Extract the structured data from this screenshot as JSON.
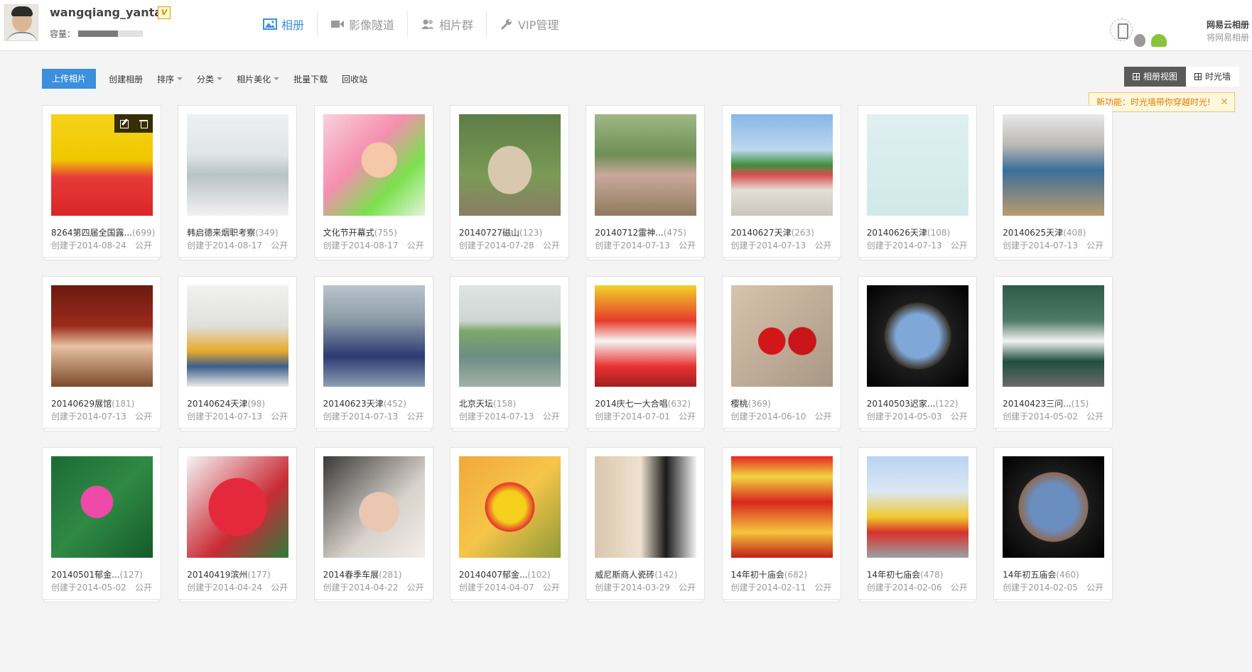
{
  "header": {
    "username": "wangqiang_yantai",
    "vip_badge": "V",
    "capacity_label": "容量：",
    "capacity_used_fraction": 0.62,
    "nav": [
      {
        "label": "相册",
        "icon": "photo-icon",
        "active": true
      },
      {
        "label": "影像隧道",
        "icon": "video-icon",
        "active": false
      },
      {
        "label": "相片群",
        "icon": "people-icon",
        "active": false
      },
      {
        "label": "VIP管理",
        "icon": "wrench-icon",
        "active": false
      }
    ],
    "promo_title": "网易云相册",
    "promo_sub": "将网易相册"
  },
  "toolbar": {
    "upload": "上传相片",
    "create": "创建相册",
    "sort": "排序",
    "category": "分类",
    "beautify": "相片美化",
    "batch_download": "批量下载",
    "recycle": "回收站"
  },
  "views": {
    "album_view": "相册视图",
    "timeline": "时光墙"
  },
  "tip": {
    "text": "新功能：时光墙带你穿越时光!",
    "close": "✕"
  },
  "albums": [
    {
      "title": "8264第四届全国露...",
      "count": "(699)",
      "date": "创建于2014-08-24",
      "privacy": "公开"
    },
    {
      "title": "韩启德来烟职考察",
      "count": "(349)",
      "date": "创建于2014-08-17",
      "privacy": "公开"
    },
    {
      "title": "文化节开幕式",
      "count": "(755)",
      "date": "创建于2014-08-17",
      "privacy": "公开"
    },
    {
      "title": "20140727磁山",
      "count": "(123)",
      "date": "创建于2014-07-28",
      "privacy": "公开"
    },
    {
      "title": "20140712雷神...",
      "count": "(475)",
      "date": "创建于2014-07-13",
      "privacy": "公开"
    },
    {
      "title": "20140627天津",
      "count": "(263)",
      "date": "创建于2014-07-13",
      "privacy": "公开"
    },
    {
      "title": "20140626天津",
      "count": "(108)",
      "date": "创建于2014-07-13",
      "privacy": "公开"
    },
    {
      "title": "20140625天津",
      "count": "(408)",
      "date": "创建于2014-07-13",
      "privacy": "公开"
    },
    {
      "title": "20140629展馆",
      "count": "(181)",
      "date": "创建于2014-07-13",
      "privacy": "公开"
    },
    {
      "title": "20140624天津",
      "count": "(98)",
      "date": "创建于2014-07-13",
      "privacy": "公开"
    },
    {
      "title": "20140623天津",
      "count": "(452)",
      "date": "创建于2014-07-13",
      "privacy": "公开"
    },
    {
      "title": "北京天坛",
      "count": "(158)",
      "date": "创建于2014-07-13",
      "privacy": "公开"
    },
    {
      "title": "2014庆七一大合唱",
      "count": "(632)",
      "date": "创建于2014-07-01",
      "privacy": "公开"
    },
    {
      "title": "樱桃",
      "count": "(369)",
      "date": "创建于2014-06-10",
      "privacy": "公开"
    },
    {
      "title": "20140503迟家...",
      "count": "(122)",
      "date": "创建于2014-05-03",
      "privacy": "公开"
    },
    {
      "title": "20140423三问...",
      "count": "(15)",
      "date": "创建于2014-05-02",
      "privacy": "公开"
    },
    {
      "title": "20140501郁金...",
      "count": "(127)",
      "date": "创建于2014-05-02",
      "privacy": "公开"
    },
    {
      "title": "20140419滨州",
      "count": "(177)",
      "date": "创建于2014-04-24",
      "privacy": "公开"
    },
    {
      "title": "2014春季车展",
      "count": "(281)",
      "date": "创建于2014-04-22",
      "privacy": "公开"
    },
    {
      "title": "20140407郁金...",
      "count": "(102)",
      "date": "创建于2014-04-07",
      "privacy": "公开"
    },
    {
      "title": "威尼斯商人瓷砖",
      "count": "(142)",
      "date": "创建于2014-03-29",
      "privacy": "公开"
    },
    {
      "title": "14年初十庙会",
      "count": "(682)",
      "date": "创建于2014-02-11",
      "privacy": "公开"
    },
    {
      "title": "14年初七庙会",
      "count": "(478)",
      "date": "创建于2014-02-06",
      "privacy": "公开"
    },
    {
      "title": "14年初五庙会",
      "count": "(460)",
      "date": "创建于2014-02-05",
      "privacy": "公开"
    }
  ],
  "colors": {
    "accent": "#3b8fdd",
    "tip_text": "#e07b00",
    "vip_gold": "#d79200"
  }
}
